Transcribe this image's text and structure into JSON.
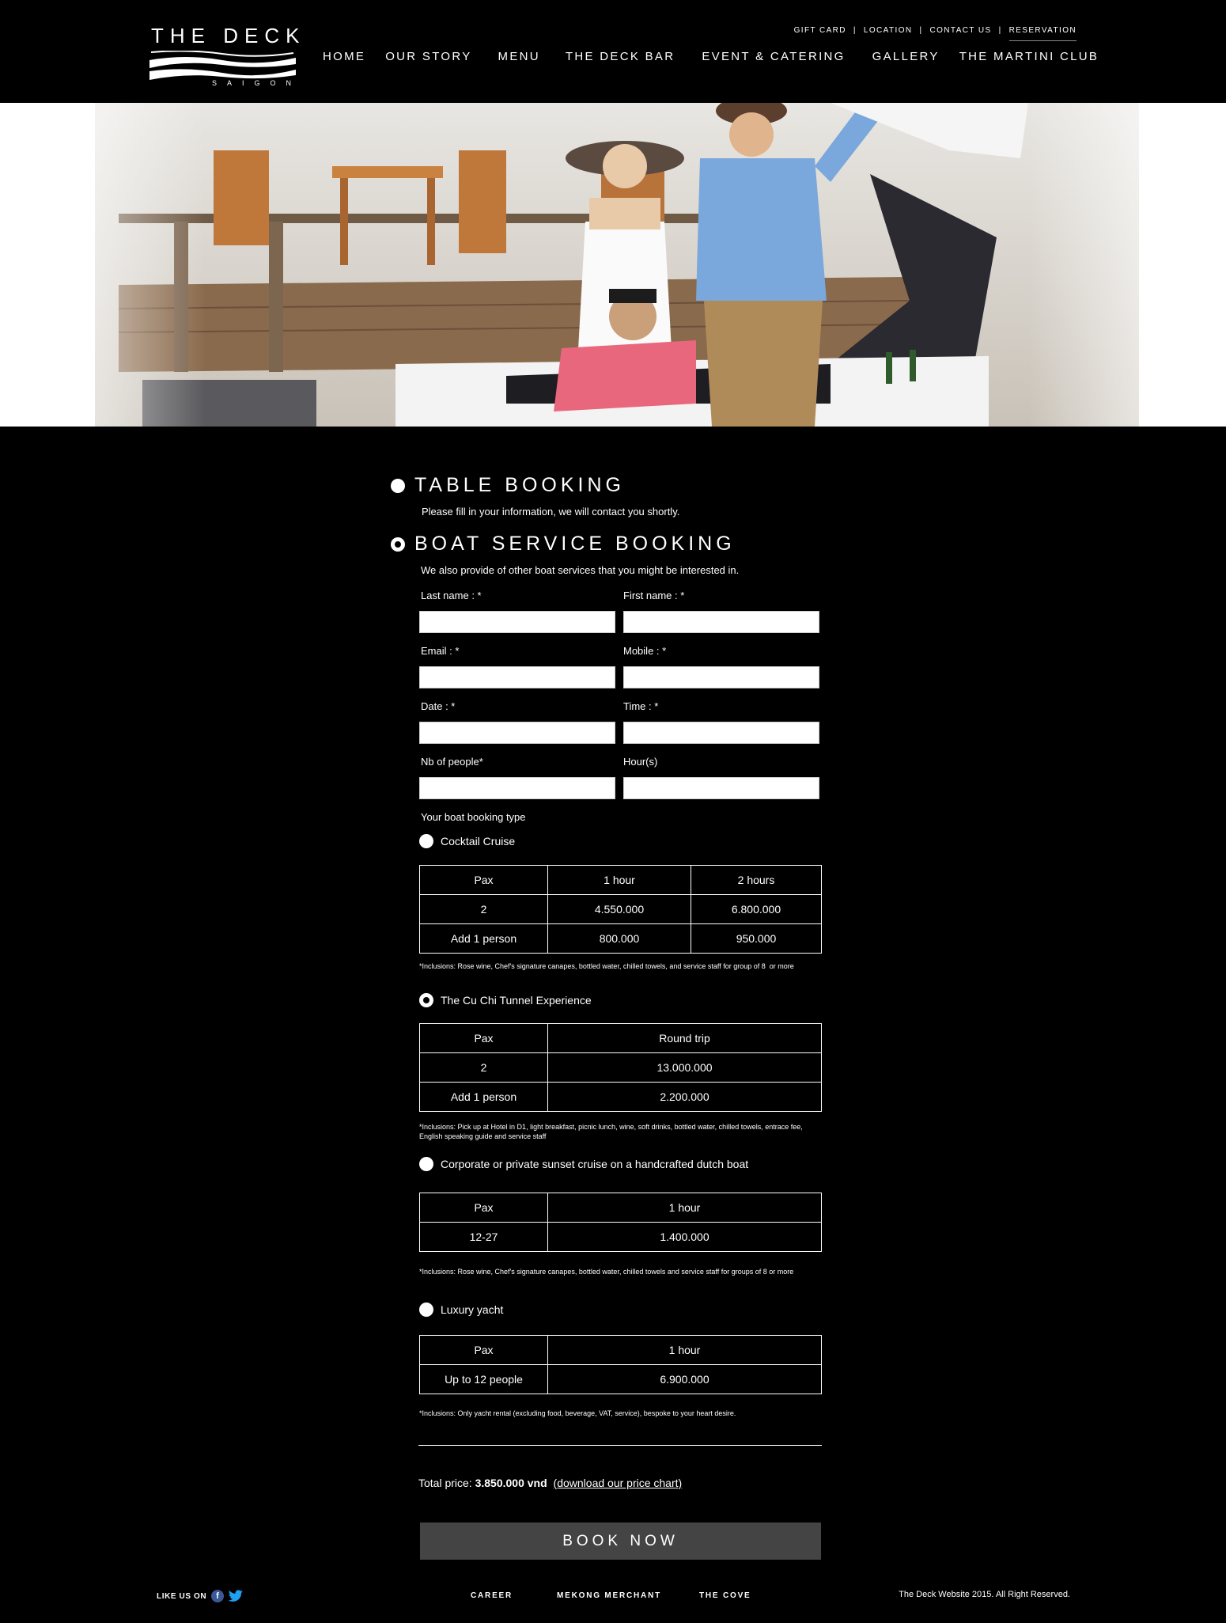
{
  "header": {
    "logo_title": "THE DECK",
    "logo_subtitle": "SAIGON",
    "top_links": [
      "GIFT CARD",
      "LOCATION",
      "CONTACT US",
      "RESERVATION"
    ],
    "top_separator": "|",
    "main_nav": [
      "HOME",
      "OUR STORY",
      "MENU",
      "THE DECK BAR",
      "EVENT & CATERING",
      "GALLERY",
      "THE MARTINI CLUB"
    ]
  },
  "table_booking": {
    "title": "TABLE BOOKING",
    "subtitle": "Please fill in your information, we will contact you shortly.",
    "selected": false
  },
  "boat_booking": {
    "title": "BOAT SERVICE BOOKING",
    "subtitle": "We also provide of other boat services that you might be interested in.",
    "selected": true
  },
  "form": {
    "last_name_label": "Last name : *",
    "first_name_label": "First name : *",
    "email_label": "Email : *",
    "mobile_label": "Mobile : *",
    "date_label": "Date : *",
    "time_label": "Time : *",
    "people_label": "Nb of people*",
    "hours_label": "Hour(s)",
    "last_name_value": "",
    "first_name_value": "",
    "email_value": "",
    "mobile_value": "",
    "date_value": "",
    "time_value": "",
    "people_value": "",
    "hours_value": "",
    "booking_type_label": "Your boat booking type"
  },
  "options": {
    "cocktail": {
      "label": "Cocktail Cruise",
      "selected": false,
      "headers": [
        "Pax",
        "1 hour",
        "2 hours"
      ],
      "rows": [
        [
          "2",
          "4.550.000",
          "6.800.000"
        ],
        [
          "Add 1 person",
          "800.000",
          "950.000"
        ]
      ],
      "note": "*Inclusions: Rose wine, Chef's signature canapes, bottled water, chilled towels, and service staff for group of 8  or more"
    },
    "cuchi": {
      "label": "The Cu Chi Tunnel Experience",
      "selected": true,
      "headers": [
        "Pax",
        "Round trip"
      ],
      "rows": [
        [
          "2",
          "13.000.000"
        ],
        [
          "Add 1 person",
          "2.200.000"
        ]
      ],
      "note": "*Inclusions: Pick up at Hotel in D1, light breakfast, picnic lunch, wine, soft drinks, bottled water, chilled towels, entrace fee, English speaking guide and service staff"
    },
    "sunset": {
      "label": "Corporate or private sunset cruise on a handcrafted dutch boat",
      "selected": false,
      "headers": [
        "Pax",
        "1 hour"
      ],
      "rows": [
        [
          "12-27",
          "1.400.000"
        ]
      ],
      "note": "*Inclusions: Rose wine, Chef's signature canapes, bottled water, chilled towels and service staff for groups of 8 or more"
    },
    "yacht": {
      "label": "Luxury yacht",
      "selected": false,
      "headers": [
        "Pax",
        "1 hour"
      ],
      "rows": [
        [
          "Up to 12 people",
          "6.900.000"
        ]
      ],
      "note": "*Inclusions: Only yacht rental (excluding food, beverage, VAT, service), bespoke to your heart desire."
    }
  },
  "total": {
    "label": "Total price:",
    "value": "3.850.000 vnd",
    "link": "(download our price chart)"
  },
  "book_button": "BOOK NOW",
  "footer": {
    "like_label": "LIKE US ON",
    "facebook_glyph": "f",
    "links": [
      "CAREER",
      "MEKONG MERCHANT",
      "THE COVE"
    ],
    "copyright": "The Deck Website 2015. All Right Reserved."
  },
  "colors": {
    "background": "#000000",
    "button": "#444444",
    "facebook": "#3b5998",
    "twitter": "#1da1f2"
  }
}
